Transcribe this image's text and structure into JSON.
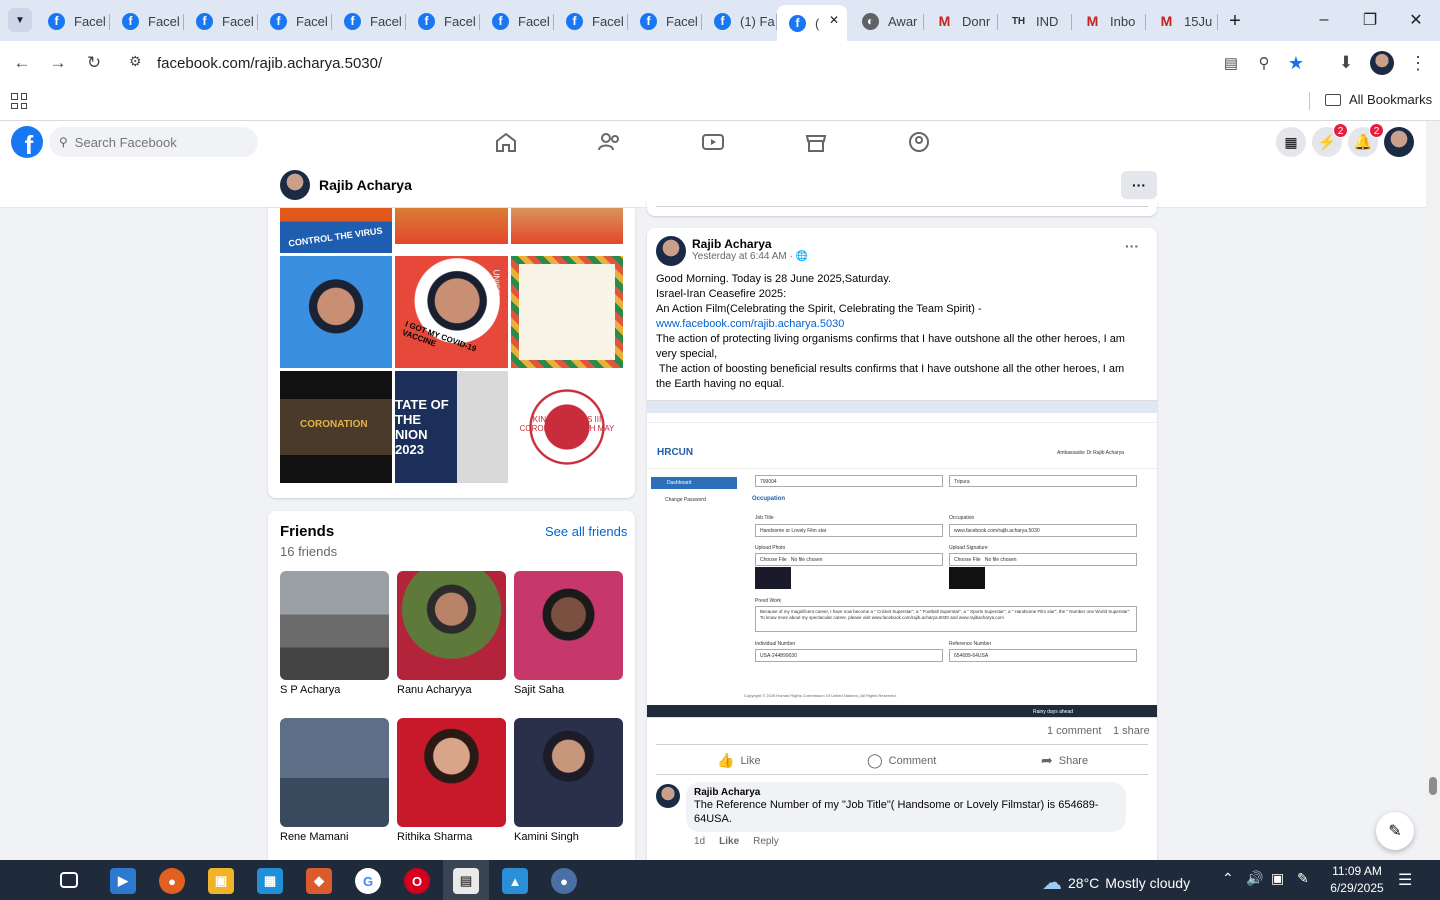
{
  "browser": {
    "tabs": [
      {
        "title": "Facel",
        "icon": "facebook-icon"
      },
      {
        "title": "Facel",
        "icon": "facebook-icon"
      },
      {
        "title": "Facel",
        "icon": "facebook-icon"
      },
      {
        "title": "Facel",
        "icon": "facebook-icon"
      },
      {
        "title": "Facel",
        "icon": "facebook-icon"
      },
      {
        "title": "Facel",
        "icon": "facebook-icon"
      },
      {
        "title": "Facel",
        "icon": "facebook-icon"
      },
      {
        "title": "Facel",
        "icon": "facebook-icon"
      },
      {
        "title": "Facel",
        "icon": "facebook-icon"
      },
      {
        "title": "(1) Fa",
        "icon": "facebook-icon"
      },
      {
        "title": "(",
        "icon": "facebook-icon",
        "active": true
      },
      {
        "title": "Awar",
        "icon": "globe-icon"
      },
      {
        "title": "Donr",
        "icon": "gmail-icon"
      },
      {
        "title": "IND",
        "icon": "th-icon"
      },
      {
        "title": "Inbo",
        "icon": "gmail-icon"
      },
      {
        "title": "15Ju",
        "icon": "gmail-icon"
      }
    ],
    "url": "facebook.com/rajib.acharya.5030/",
    "bookmarks_label": "All Bookmarks"
  },
  "facebook": {
    "search_placeholder": "Search Facebook",
    "messenger_badge": "2",
    "notifications_badge": "2",
    "profile_name": "Rajib Acharya",
    "more_label": "···"
  },
  "photos": {
    "captions": [
      "CONTROL THE VIRUS",
      "I GOT MY COVID-19 VACCINE",
      "UNICEF",
      "CORONATION",
      "TATE OF THE NION 2023",
      "KING CHARLES III CORONATION · 6TH MAY 2023"
    ]
  },
  "friends": {
    "title": "Friends",
    "see_all": "See all friends",
    "count": "16 friends",
    "list": [
      {
        "name": "S P Acharya"
      },
      {
        "name": "Ranu Acharyya"
      },
      {
        "name": "Sajit Saha"
      },
      {
        "name": "Rene Mamani"
      },
      {
        "name": "Rithika Sharma"
      },
      {
        "name": "Kamini Singh"
      }
    ]
  },
  "post": {
    "author": "Rajib Acharya",
    "time": "Yesterday at 6:44 AM · ",
    "lines": [
      "Good Morning. Today is 28 June 2025,Saturday.",
      "Israel-Iran Ceasefire 2025:",
      "An Action Film(Celebrating the Spirit, Celebrating the Team Spirit) -",
      "The action of protecting living organisms confirms that I have outshone all the other heroes, I am",
      "very special,",
      " The action of boosting beneficial results confirms that I have outshone all the other heroes, I am",
      "the Earth having no equal."
    ],
    "link": "www.facebook.com/rajib.acharya.5030",
    "comments_count": "1 comment",
    "shares_count": "1 share",
    "like": "Like",
    "comment": "Comment",
    "share": "Share",
    "screenshot": {
      "logo": "HRCUN",
      "dashboard": "Dashboard",
      "change_password": "Change Password",
      "ambassador": "Ambassador Dr Rajib Acharya",
      "field_pin": "799004",
      "field_state": "Tripura",
      "section": "Occupation",
      "job_title_label": "Job Title",
      "job_title_value": "Handsome or Lovely Film star",
      "occupation_label": "Occupation",
      "occupation_value": "www.facebook.com/rajib.acharya.5030",
      "upload_photo": "Upload Photo",
      "upload_signature": "Upload Signature",
      "choose_file": "Choose File",
      "no_file": "No file chosen",
      "prev_work": "Prevd Work",
      "prev_work_text": "Because of my magnificent career, I have now become a \" Cricket Superstar\", a \" Football Superstar\", a \" Sports Superstar\", a \" Handsome Film star\", the \" Number one World Superstar\".",
      "prev_work_text2": "To know more about my spectacular career, please visit www.facebook.com/rajib.acharya.5030 and www.rajibacharya.com",
      "individual_label": "Individual Number",
      "individual_value": "USA-244899030",
      "reference_label": "Reference Number",
      "reference_value": "654689-64USA",
      "copyright": "Copyright © 2025 Human Rights Commission Of United Nations | All Rights Reserved.",
      "weather": "Rainy days ahead"
    }
  },
  "comment": {
    "author": "Rajib Acharya",
    "text1": "The Reference Number of my \"Job Title\"( Handsome or Lovely Filmstar) is 654689-",
    "text2": "64USA.",
    "age": "1d",
    "like": "Like",
    "reply": "Reply"
  },
  "taskbar": {
    "weather_temp": "28°C",
    "weather_desc": "Mostly cloudy",
    "time": "11:09 AM",
    "date": "6/29/2025"
  }
}
